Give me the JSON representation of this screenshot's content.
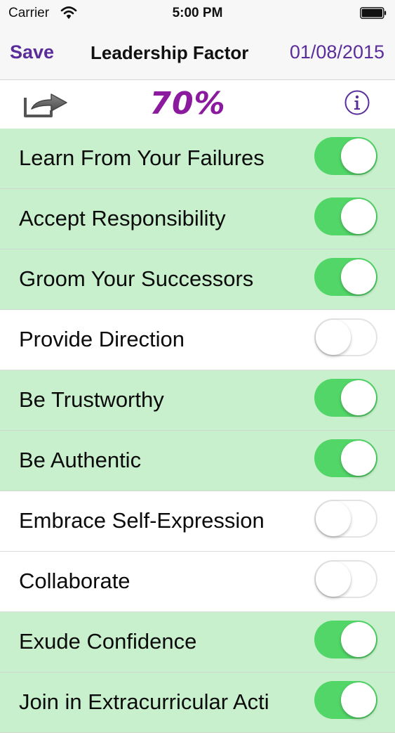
{
  "status_bar": {
    "carrier": "Carrier",
    "time": "5:00 PM",
    "wifi_icon": "wifi-icon",
    "battery_icon": "battery-icon"
  },
  "nav": {
    "save_label": "Save",
    "title": "Leadership Factor",
    "date": "01/08/2015"
  },
  "toolbar": {
    "share_icon": "share-icon",
    "percent": "70%",
    "info_icon": "info-icon"
  },
  "colors": {
    "accent": "#5b2d9a",
    "percent": "#8b1a9e",
    "row_on": "#c8f0cc",
    "switch_on": "#52d668"
  },
  "items": [
    {
      "label": "Learn From Your Failures",
      "on": true
    },
    {
      "label": "Accept Responsibility",
      "on": true
    },
    {
      "label": "Groom Your Successors",
      "on": true
    },
    {
      "label": "Provide Direction",
      "on": false
    },
    {
      "label": "Be Trustworthy",
      "on": true
    },
    {
      "label": "Be Authentic",
      "on": true
    },
    {
      "label": "Embrace Self-Expression",
      "on": false
    },
    {
      "label": "Collaborate",
      "on": false
    },
    {
      "label": "Exude Confidence",
      "on": true
    },
    {
      "label": "Join in Extracurricular Acti",
      "on": true
    }
  ]
}
